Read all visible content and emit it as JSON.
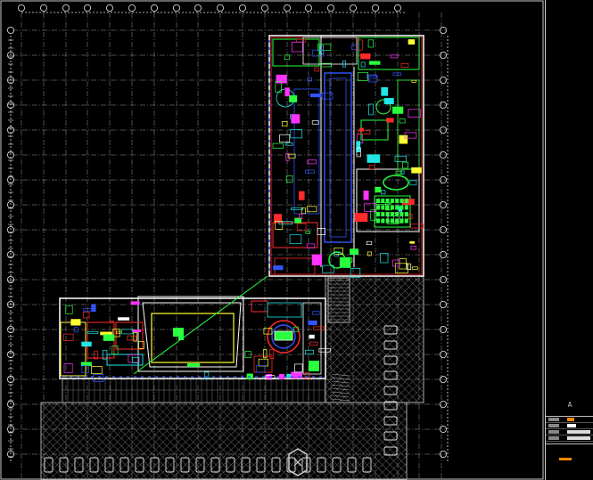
{
  "canvas": {
    "background": "#000000"
  },
  "colors": {
    "grid": "#9a9a9a",
    "axis_bubble": "#e6e6e6",
    "wall": "#ffffff",
    "red": "#ff2a2a",
    "green": "#29ff3d",
    "blue": "#3355ff",
    "cyan": "#22e6e6",
    "yellow": "#ffff33",
    "magenta": "#ff33ff",
    "orange": "#ff8a00",
    "hatch": "#8c8c8c"
  },
  "title_block": {
    "sheet_label": "A",
    "rows": [
      "",
      "",
      "",
      ""
    ],
    "drawing_name": ""
  }
}
